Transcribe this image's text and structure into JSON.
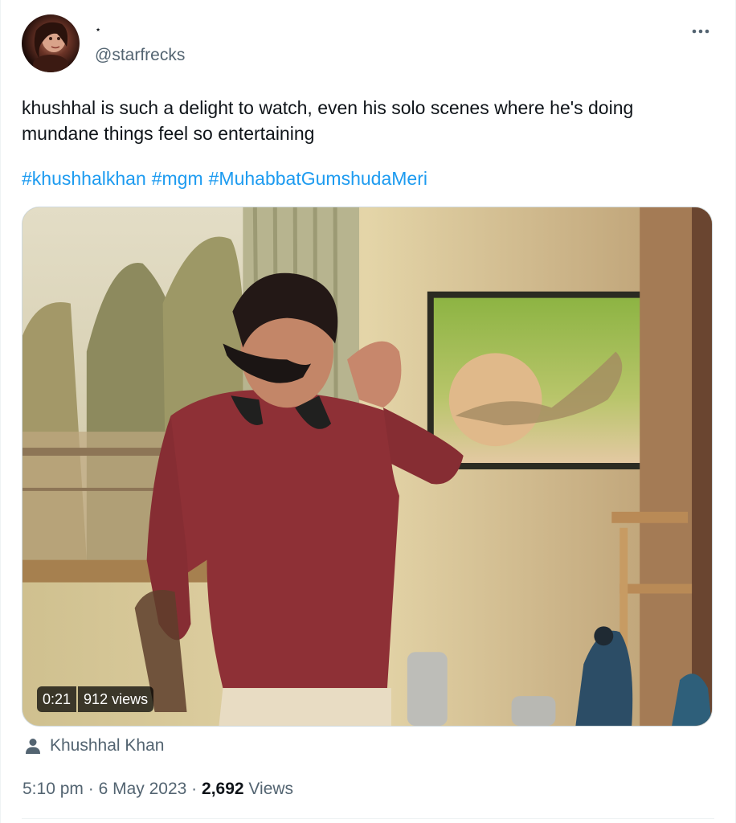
{
  "author": {
    "display_name": "⋆",
    "handle": "@starfrecks"
  },
  "tweet": {
    "text": "khushhal is such a delight to watch, even his solo scenes where he's doing mundane things feel so entertaining",
    "hashtags": [
      "#khushhalkhan",
      "#mgm",
      "#MuhabbatGumshudaMeri"
    ]
  },
  "video": {
    "duration": "0:21",
    "views": "912 views"
  },
  "tagged_user": "Khushhal Khan",
  "meta": {
    "time": "5:10 pm",
    "separator": "·",
    "date": "6 May 2023",
    "views_count": "2,692",
    "views_label": "Views"
  },
  "icons": {
    "more": "more-horizontal-icon",
    "person": "person-icon"
  },
  "colors": {
    "link": "#1d9bf0",
    "secondary_text": "#536471",
    "primary_text": "#0f1419"
  }
}
